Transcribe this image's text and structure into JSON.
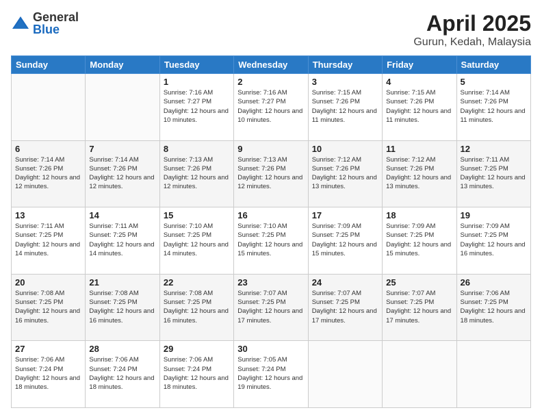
{
  "logo": {
    "general": "General",
    "blue": "Blue"
  },
  "title": "April 2025",
  "subtitle": "Gurun, Kedah, Malaysia",
  "weekdays": [
    "Sunday",
    "Monday",
    "Tuesday",
    "Wednesday",
    "Thursday",
    "Friday",
    "Saturday"
  ],
  "weeks": [
    [
      {
        "day": "",
        "sunrise": "",
        "sunset": "",
        "daylight": ""
      },
      {
        "day": "",
        "sunrise": "",
        "sunset": "",
        "daylight": ""
      },
      {
        "day": "1",
        "sunrise": "Sunrise: 7:16 AM",
        "sunset": "Sunset: 7:27 PM",
        "daylight": "Daylight: 12 hours and 10 minutes."
      },
      {
        "day": "2",
        "sunrise": "Sunrise: 7:16 AM",
        "sunset": "Sunset: 7:27 PM",
        "daylight": "Daylight: 12 hours and 10 minutes."
      },
      {
        "day": "3",
        "sunrise": "Sunrise: 7:15 AM",
        "sunset": "Sunset: 7:26 PM",
        "daylight": "Daylight: 12 hours and 11 minutes."
      },
      {
        "day": "4",
        "sunrise": "Sunrise: 7:15 AM",
        "sunset": "Sunset: 7:26 PM",
        "daylight": "Daylight: 12 hours and 11 minutes."
      },
      {
        "day": "5",
        "sunrise": "Sunrise: 7:14 AM",
        "sunset": "Sunset: 7:26 PM",
        "daylight": "Daylight: 12 hours and 11 minutes."
      }
    ],
    [
      {
        "day": "6",
        "sunrise": "Sunrise: 7:14 AM",
        "sunset": "Sunset: 7:26 PM",
        "daylight": "Daylight: 12 hours and 12 minutes."
      },
      {
        "day": "7",
        "sunrise": "Sunrise: 7:14 AM",
        "sunset": "Sunset: 7:26 PM",
        "daylight": "Daylight: 12 hours and 12 minutes."
      },
      {
        "day": "8",
        "sunrise": "Sunrise: 7:13 AM",
        "sunset": "Sunset: 7:26 PM",
        "daylight": "Daylight: 12 hours and 12 minutes."
      },
      {
        "day": "9",
        "sunrise": "Sunrise: 7:13 AM",
        "sunset": "Sunset: 7:26 PM",
        "daylight": "Daylight: 12 hours and 12 minutes."
      },
      {
        "day": "10",
        "sunrise": "Sunrise: 7:12 AM",
        "sunset": "Sunset: 7:26 PM",
        "daylight": "Daylight: 12 hours and 13 minutes."
      },
      {
        "day": "11",
        "sunrise": "Sunrise: 7:12 AM",
        "sunset": "Sunset: 7:26 PM",
        "daylight": "Daylight: 12 hours and 13 minutes."
      },
      {
        "day": "12",
        "sunrise": "Sunrise: 7:11 AM",
        "sunset": "Sunset: 7:25 PM",
        "daylight": "Daylight: 12 hours and 13 minutes."
      }
    ],
    [
      {
        "day": "13",
        "sunrise": "Sunrise: 7:11 AM",
        "sunset": "Sunset: 7:25 PM",
        "daylight": "Daylight: 12 hours and 14 minutes."
      },
      {
        "day": "14",
        "sunrise": "Sunrise: 7:11 AM",
        "sunset": "Sunset: 7:25 PM",
        "daylight": "Daylight: 12 hours and 14 minutes."
      },
      {
        "day": "15",
        "sunrise": "Sunrise: 7:10 AM",
        "sunset": "Sunset: 7:25 PM",
        "daylight": "Daylight: 12 hours and 14 minutes."
      },
      {
        "day": "16",
        "sunrise": "Sunrise: 7:10 AM",
        "sunset": "Sunset: 7:25 PM",
        "daylight": "Daylight: 12 hours and 15 minutes."
      },
      {
        "day": "17",
        "sunrise": "Sunrise: 7:09 AM",
        "sunset": "Sunset: 7:25 PM",
        "daylight": "Daylight: 12 hours and 15 minutes."
      },
      {
        "day": "18",
        "sunrise": "Sunrise: 7:09 AM",
        "sunset": "Sunset: 7:25 PM",
        "daylight": "Daylight: 12 hours and 15 minutes."
      },
      {
        "day": "19",
        "sunrise": "Sunrise: 7:09 AM",
        "sunset": "Sunset: 7:25 PM",
        "daylight": "Daylight: 12 hours and 16 minutes."
      }
    ],
    [
      {
        "day": "20",
        "sunrise": "Sunrise: 7:08 AM",
        "sunset": "Sunset: 7:25 PM",
        "daylight": "Daylight: 12 hours and 16 minutes."
      },
      {
        "day": "21",
        "sunrise": "Sunrise: 7:08 AM",
        "sunset": "Sunset: 7:25 PM",
        "daylight": "Daylight: 12 hours and 16 minutes."
      },
      {
        "day": "22",
        "sunrise": "Sunrise: 7:08 AM",
        "sunset": "Sunset: 7:25 PM",
        "daylight": "Daylight: 12 hours and 16 minutes."
      },
      {
        "day": "23",
        "sunrise": "Sunrise: 7:07 AM",
        "sunset": "Sunset: 7:25 PM",
        "daylight": "Daylight: 12 hours and 17 minutes."
      },
      {
        "day": "24",
        "sunrise": "Sunrise: 7:07 AM",
        "sunset": "Sunset: 7:25 PM",
        "daylight": "Daylight: 12 hours and 17 minutes."
      },
      {
        "day": "25",
        "sunrise": "Sunrise: 7:07 AM",
        "sunset": "Sunset: 7:25 PM",
        "daylight": "Daylight: 12 hours and 17 minutes."
      },
      {
        "day": "26",
        "sunrise": "Sunrise: 7:06 AM",
        "sunset": "Sunset: 7:25 PM",
        "daylight": "Daylight: 12 hours and 18 minutes."
      }
    ],
    [
      {
        "day": "27",
        "sunrise": "Sunrise: 7:06 AM",
        "sunset": "Sunset: 7:24 PM",
        "daylight": "Daylight: 12 hours and 18 minutes."
      },
      {
        "day": "28",
        "sunrise": "Sunrise: 7:06 AM",
        "sunset": "Sunset: 7:24 PM",
        "daylight": "Daylight: 12 hours and 18 minutes."
      },
      {
        "day": "29",
        "sunrise": "Sunrise: 7:06 AM",
        "sunset": "Sunset: 7:24 PM",
        "daylight": "Daylight: 12 hours and 18 minutes."
      },
      {
        "day": "30",
        "sunrise": "Sunrise: 7:05 AM",
        "sunset": "Sunset: 7:24 PM",
        "daylight": "Daylight: 12 hours and 19 minutes."
      },
      {
        "day": "",
        "sunrise": "",
        "sunset": "",
        "daylight": ""
      },
      {
        "day": "",
        "sunrise": "",
        "sunset": "",
        "daylight": ""
      },
      {
        "day": "",
        "sunrise": "",
        "sunset": "",
        "daylight": ""
      }
    ]
  ]
}
